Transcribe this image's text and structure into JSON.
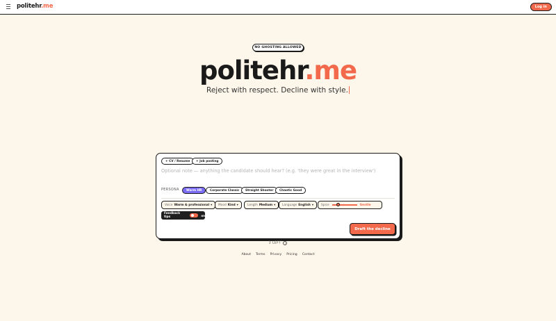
{
  "header": {
    "brand_name": "politehr",
    "brand_tld": ".me",
    "login_label": "Log in"
  },
  "hero": {
    "badge": "NO GHOSTING ALLOWED",
    "title_main": "politehr",
    "title_tld": ".me",
    "tagline": "Reject with respect. Decline with style."
  },
  "composer": {
    "attach_cv": "+ CV / Resume",
    "attach_job": "+ Job posting",
    "note_placeholder": "Optional note — anything the candidate should hear? (e.g. 'they were great in the interview')",
    "persona_label": "PERSONA",
    "personas": [
      "Warm HR",
      "Corporate Classic",
      "Straight Shooter",
      "Chaotic Good"
    ],
    "selected_persona": "Warm HR",
    "options": {
      "voice_label": "Voice",
      "voice_value": "Warm & professional",
      "mood_label": "Mood",
      "mood_value": "Kind",
      "length_label": "Length",
      "length_value": "Medium",
      "language_label": "Language",
      "language_value": "English",
      "spice_label": "Spice",
      "spice_value": "Gentle",
      "spice_level": 0.25
    },
    "feedback_label": "Feedback tips",
    "feedback_state": "on",
    "draft_label": "Draft the decline"
  },
  "usage": {
    "remaining": "3 LEFT"
  },
  "footer": {
    "links": [
      "About",
      "Terms",
      "Privacy",
      "Pricing",
      "Contact"
    ]
  },
  "colors": {
    "accent": "#f26a4b",
    "persona_active": "#7b6cf6",
    "background": "#fdf6ea"
  },
  "icons": {
    "menu": "hamburger-icon",
    "info": "info-icon",
    "chevron": "chevron-down-icon"
  }
}
